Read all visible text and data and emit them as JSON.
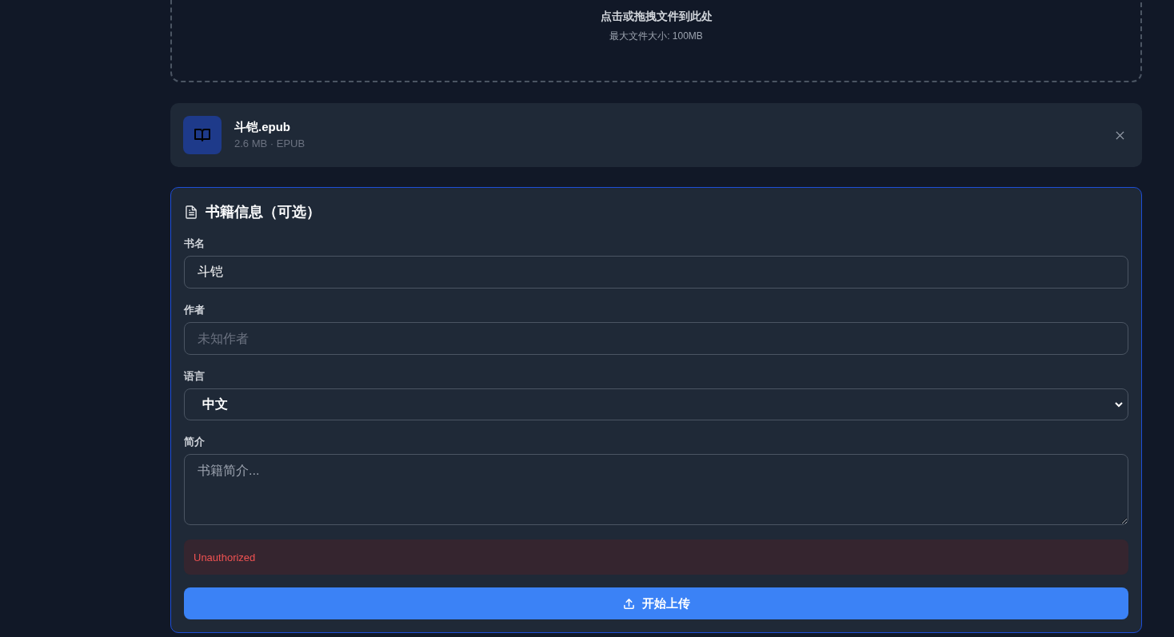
{
  "dropzone": {
    "title": "点击或拖拽文件到此处",
    "hint": "最大文件大小: 100MB"
  },
  "file": {
    "name": "斗铠.epub",
    "meta": "2.6 MB · EPUB"
  },
  "book_info": {
    "title": "书籍信息（可选）",
    "fields": [
      {
        "kind": "text",
        "label": "书名",
        "value": "斗铠"
      },
      {
        "kind": "text",
        "label": "作者",
        "placeholder": "未知作者"
      },
      {
        "kind": "select",
        "label": "语言",
        "value": "中文"
      },
      {
        "kind": "textarea",
        "label": "简介",
        "placeholder": "书籍简介..."
      }
    ],
    "error": "Unauthorized",
    "submit_button": "开始上传"
  }
}
